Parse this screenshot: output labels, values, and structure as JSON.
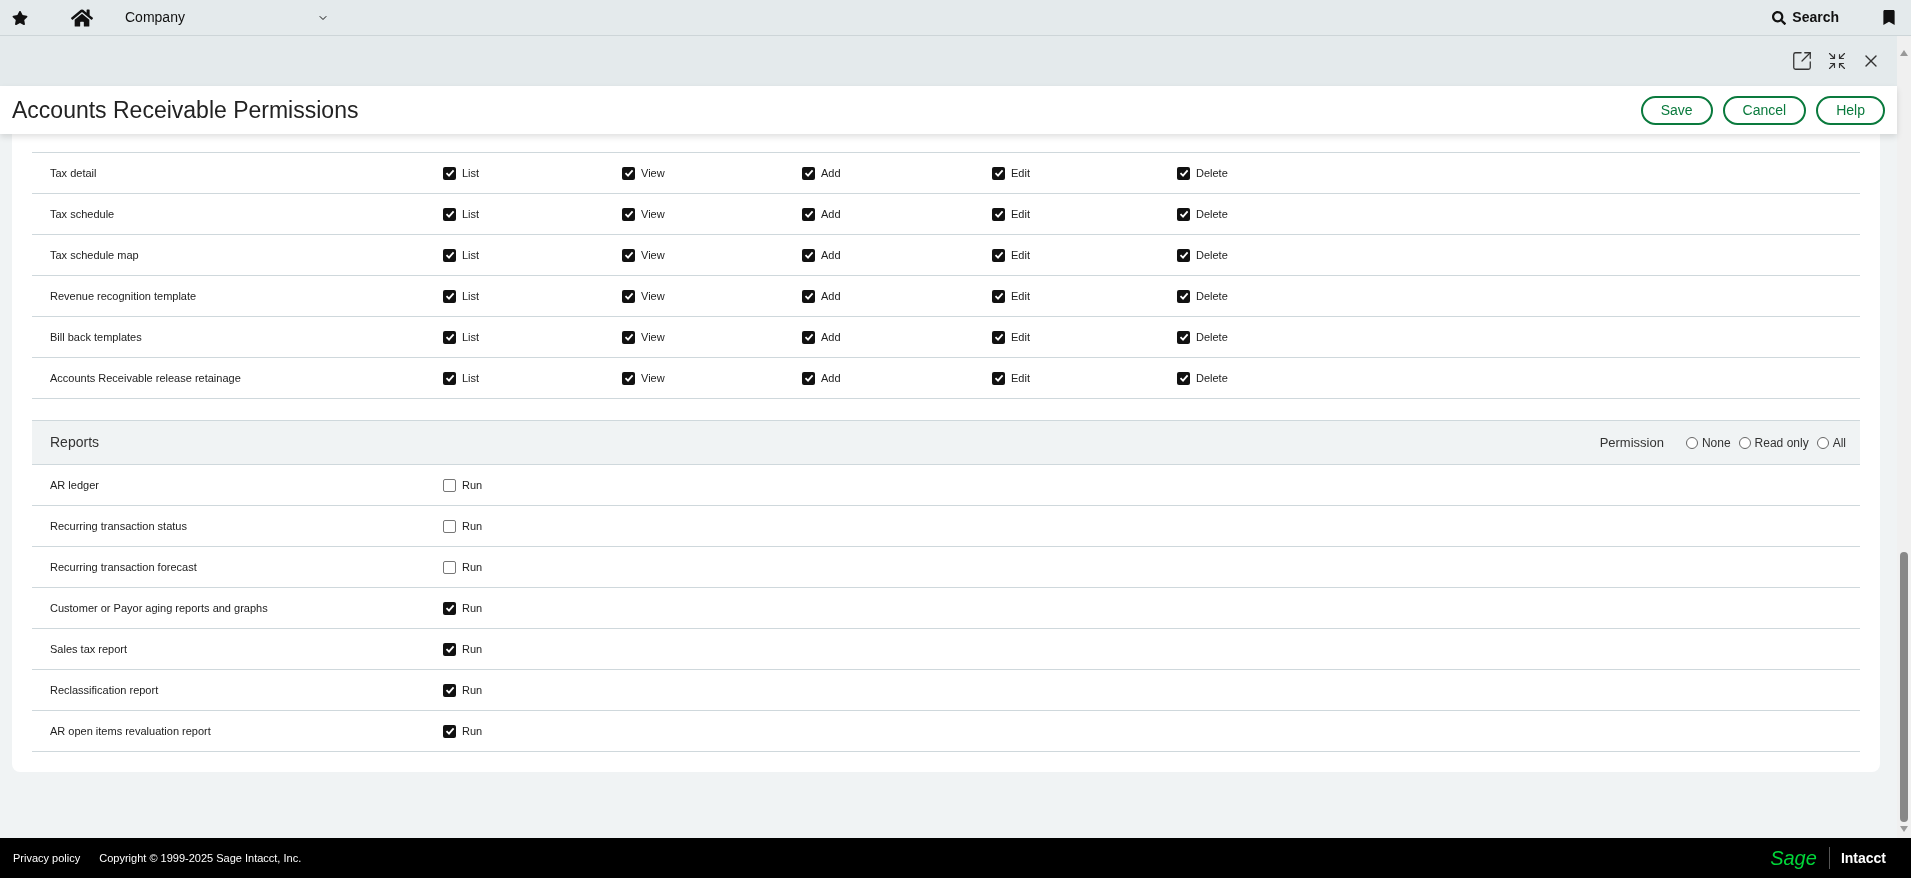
{
  "top_bar": {
    "menu": "Company",
    "search": "Search"
  },
  "title": "Accounts Receivable Permissions",
  "buttons": [
    "Save",
    "Cancel",
    "Help"
  ],
  "permissions_table": {
    "rows": [
      {
        "label": "Tax detail",
        "cells": [
          {
            "label": "List",
            "checked": true
          },
          {
            "label": "View",
            "checked": true
          },
          {
            "label": "Add",
            "checked": true
          },
          {
            "label": "Edit",
            "checked": true
          },
          {
            "label": "Delete",
            "checked": true
          }
        ]
      },
      {
        "label": "Tax schedule",
        "cells": [
          {
            "label": "List",
            "checked": true
          },
          {
            "label": "View",
            "checked": true
          },
          {
            "label": "Add",
            "checked": true
          },
          {
            "label": "Edit",
            "checked": true
          },
          {
            "label": "Delete",
            "checked": true
          }
        ]
      },
      {
        "label": "Tax schedule map",
        "cells": [
          {
            "label": "List",
            "checked": true
          },
          {
            "label": "View",
            "checked": true
          },
          {
            "label": "Add",
            "checked": true
          },
          {
            "label": "Edit",
            "checked": true
          },
          {
            "label": "Delete",
            "checked": true
          }
        ]
      },
      {
        "label": "Revenue recognition template",
        "cells": [
          {
            "label": "List",
            "checked": true
          },
          {
            "label": "View",
            "checked": true
          },
          {
            "label": "Add",
            "checked": true
          },
          {
            "label": "Edit",
            "checked": true
          },
          {
            "label": "Delete",
            "checked": true
          }
        ]
      },
      {
        "label": "Bill back templates",
        "cells": [
          {
            "label": "List",
            "checked": true
          },
          {
            "label": "View",
            "checked": true
          },
          {
            "label": "Add",
            "checked": true
          },
          {
            "label": "Edit",
            "checked": true
          },
          {
            "label": "Delete",
            "checked": true
          }
        ]
      },
      {
        "label": "Accounts Receivable release retainage",
        "cells": [
          {
            "label": "List",
            "checked": true
          },
          {
            "label": "View",
            "checked": true
          },
          {
            "label": "Add",
            "checked": true
          },
          {
            "label": "Edit",
            "checked": true
          },
          {
            "label": "Delete",
            "checked": true
          }
        ]
      }
    ]
  },
  "reports": {
    "title": "Reports",
    "permission_label": "Permission",
    "options": [
      {
        "label": "None",
        "selected": false
      },
      {
        "label": "Read only",
        "selected": false
      },
      {
        "label": "All",
        "selected": false
      }
    ],
    "rows": [
      {
        "label": "AR ledger",
        "cells": [
          {
            "label": "Run",
            "checked": false
          }
        ]
      },
      {
        "label": "Recurring transaction status",
        "cells": [
          {
            "label": "Run",
            "checked": false
          }
        ]
      },
      {
        "label": "Recurring transaction forecast",
        "cells": [
          {
            "label": "Run",
            "checked": false
          }
        ]
      },
      {
        "label": "Customer or Payor aging reports and graphs",
        "cells": [
          {
            "label": "Run",
            "checked": true
          }
        ]
      },
      {
        "label": "Sales tax report",
        "cells": [
          {
            "label": "Run",
            "checked": true
          }
        ]
      },
      {
        "label": "Reclassification report",
        "cells": [
          {
            "label": "Run",
            "checked": true
          }
        ]
      },
      {
        "label": "AR open items revaluation report",
        "cells": [
          {
            "label": "Run",
            "checked": true
          }
        ]
      }
    ]
  },
  "footer": {
    "privacy": "Privacy policy",
    "copyright": "Copyright © 1999-2025 Sage Intacct, Inc.",
    "brand": "Sage",
    "product": "Intacct"
  }
}
